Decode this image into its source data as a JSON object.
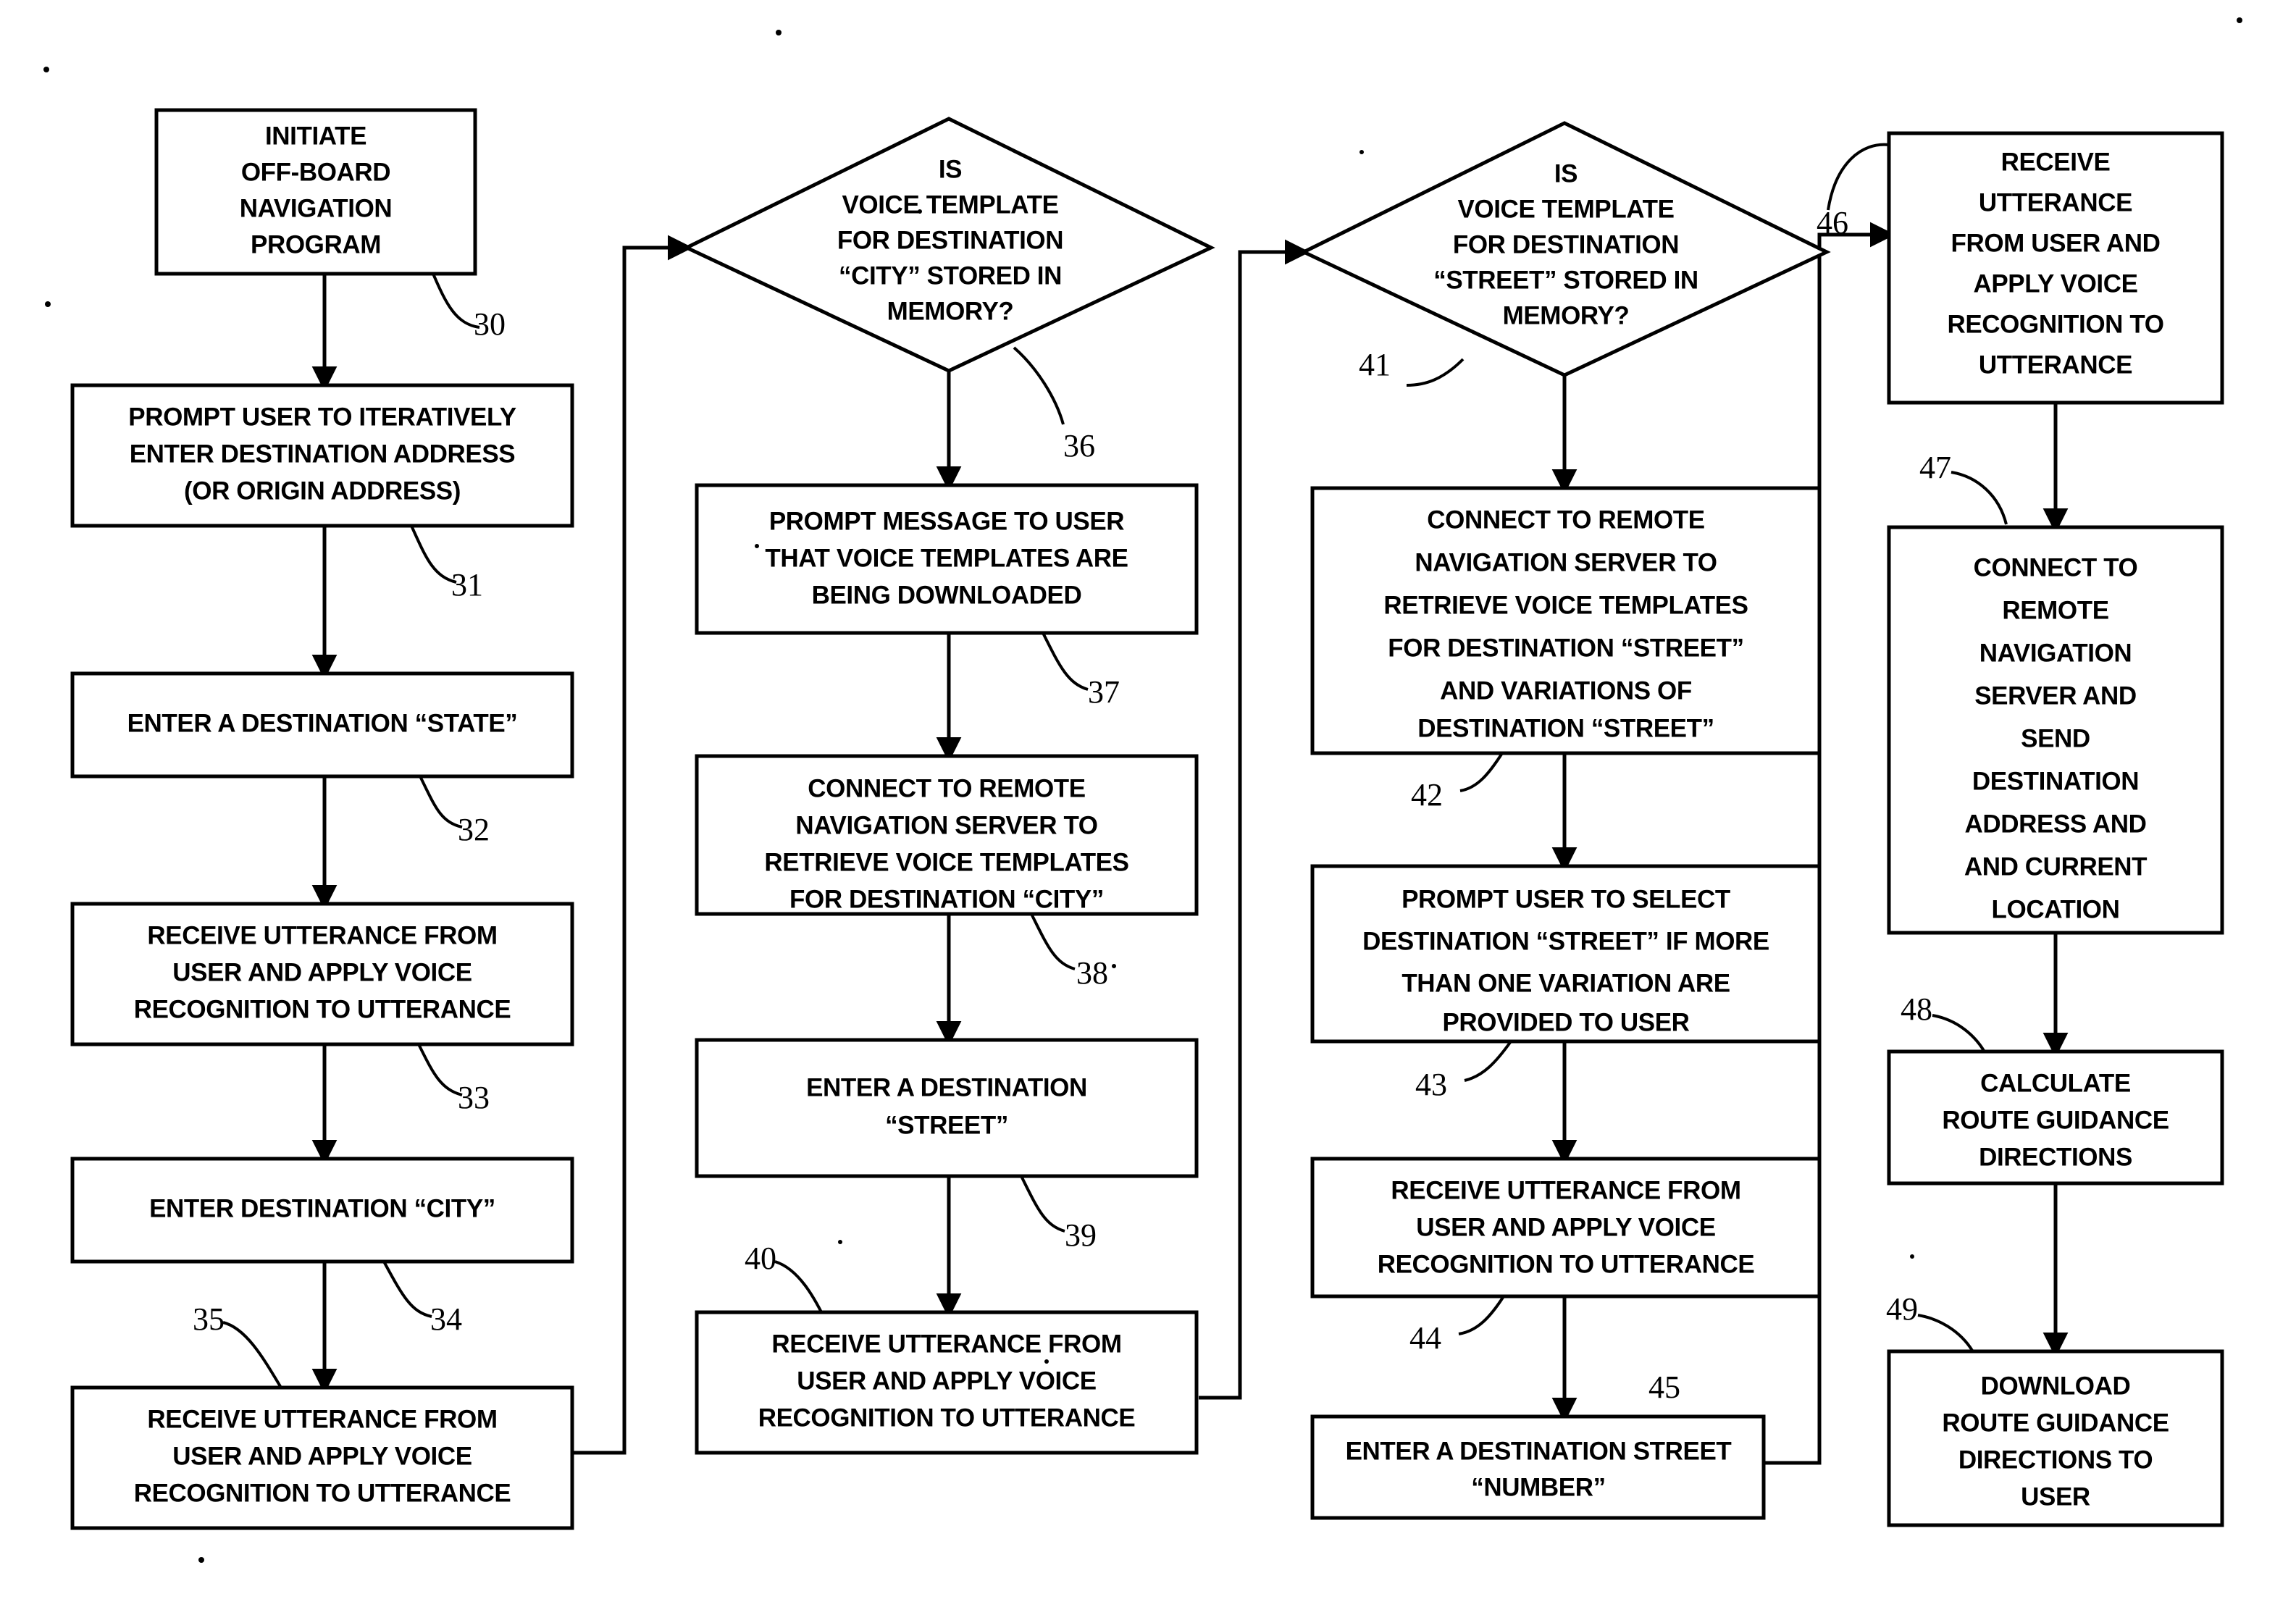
{
  "figure": {
    "type": "flowchart",
    "title": "Off-board navigation program voice template flowchart",
    "columns": 4
  },
  "nodes": [
    {
      "ref": "30",
      "shape": "rect",
      "name": "initiate-off-board-navigation-program",
      "lines": [
        "INITIATE",
        "OFF-BOARD",
        "NAVIGATION",
        "PROGRAM"
      ]
    },
    {
      "ref": "31",
      "shape": "rect",
      "name": "prompt-user-enter-destination-address",
      "lines": [
        "PROMPT USER TO ITERATIVELY",
        "ENTER DESTINATION  ADDRESS",
        "(OR ORIGIN ADDRESS)"
      ]
    },
    {
      "ref": "32",
      "shape": "rect",
      "name": "enter-a-destination-state",
      "lines": [
        "ENTER A DESTINATION “STATE”"
      ]
    },
    {
      "ref": "33",
      "shape": "rect",
      "name": "receive-utterance-state",
      "lines": [
        "RECEIVE UTTERANCE FROM",
        "USER AND APPLY VOICE",
        "RECOGNITION TO UTTERANCE"
      ]
    },
    {
      "ref": "34",
      "shape": "rect",
      "name": "enter-destination-city",
      "lines": [
        "ENTER DESTINATION “CITY”"
      ]
    },
    {
      "ref": "35",
      "shape": "rect",
      "name": "receive-utterance-city",
      "lines": [
        "RECEIVE UTTERANCE FROM",
        "USER AND APPLY VOICE",
        "RECOGNITION TO UTTERANCE"
      ]
    },
    {
      "ref": "36",
      "shape": "diamond",
      "name": "is-voice-template-city-stored-in-memory",
      "lines": [
        "IS",
        "VOICE TEMPLATE",
        "FOR DESTINATION",
        "“CITY” STORED IN",
        "MEMORY?"
      ]
    },
    {
      "ref": "37",
      "shape": "rect",
      "name": "prompt-message-templates-downloading",
      "lines": [
        "PROMPT MESSAGE TO USER",
        "THAT VOICE TEMPLATES ARE",
        "BEING DOWNLOADED"
      ]
    },
    {
      "ref": "38",
      "shape": "rect",
      "name": "connect-remote-server-retrieve-city-templates",
      "lines": [
        "CONNECT TO REMOTE",
        "NAVIGATION SERVER TO",
        "RETRIEVE VOICE TEMPLATES",
        "FOR DESTINATION “CITY”"
      ]
    },
    {
      "ref": "39",
      "shape": "rect",
      "name": "enter-a-destination-street",
      "lines": [
        "ENTER A DESTINATION",
        "“STREET”"
      ]
    },
    {
      "ref": "40",
      "shape": "rect",
      "name": "receive-utterance-street",
      "lines": [
        "RECEIVE UTTERANCE FROM",
        "USER AND APPLY VOICE",
        "RECOGNITION TO UTTERANCE"
      ]
    },
    {
      "ref": "41",
      "shape": "diamond",
      "name": "is-voice-template-street-stored-in-memory",
      "lines": [
        "IS",
        "VOICE TEMPLATE",
        "FOR DESTINATION",
        "“STREET” STORED IN",
        "MEMORY?"
      ]
    },
    {
      "ref": "42",
      "shape": "rect",
      "name": "connect-remote-server-retrieve-street-templates",
      "lines": [
        "CONNECT TO REMOTE",
        "NAVIGATION SERVER TO",
        "RETRIEVE VOICE TEMPLATES",
        "FOR DESTINATION “STREET”",
        "AND VARIATIONS OF",
        "DESTINATION “STREET”"
      ]
    },
    {
      "ref": "43",
      "shape": "rect",
      "name": "prompt-user-select-street-variation",
      "lines": [
        "PROMPT USER TO SELECT",
        "DESTINATION “STREET” IF MORE",
        "THAN ONE VARIATION ARE",
        "PROVIDED TO USER"
      ]
    },
    {
      "ref": "44",
      "shape": "rect",
      "name": "receive-utterance-street-selection",
      "lines": [
        "RECEIVE UTTERANCE FROM",
        "USER AND APPLY VOICE",
        "RECOGNITION TO UTTERANCE"
      ]
    },
    {
      "ref": "45",
      "shape": "rect",
      "name": "enter-a-destination-street-number",
      "lines": [
        "ENTER A DESTINATION STREET",
        "“NUMBER”"
      ]
    },
    {
      "ref": "46",
      "shape": "rect",
      "name": "receive-utterance-number",
      "lines": [
        "RECEIVE",
        "UTTERANCE",
        "FROM USER AND",
        "APPLY VOICE",
        "RECOGNITION TO",
        "UTTERANCE"
      ]
    },
    {
      "ref": "47",
      "shape": "rect",
      "name": "connect-remote-server-send-address-location",
      "lines": [
        "CONNECT TO",
        "REMOTE",
        "NAVIGATION",
        "SERVER AND",
        "SEND",
        "DESTINATION",
        "ADDRESS AND",
        "AND CURRENT",
        "LOCATION"
      ]
    },
    {
      "ref": "48",
      "shape": "rect",
      "name": "calculate-route-guidance-directions",
      "lines": [
        "CALCULATE",
        "ROUTE GUIDANCE",
        "DIRECTIONS"
      ]
    },
    {
      "ref": "49",
      "shape": "rect",
      "name": "download-route-guidance-directions-to-user",
      "lines": [
        "DOWNLOAD",
        "ROUTE GUIDANCE",
        "DIRECTIONS TO",
        "USER"
      ]
    }
  ],
  "colors": {
    "stroke": "#000000",
    "fill": "#ffffff",
    "text": "#000000"
  }
}
